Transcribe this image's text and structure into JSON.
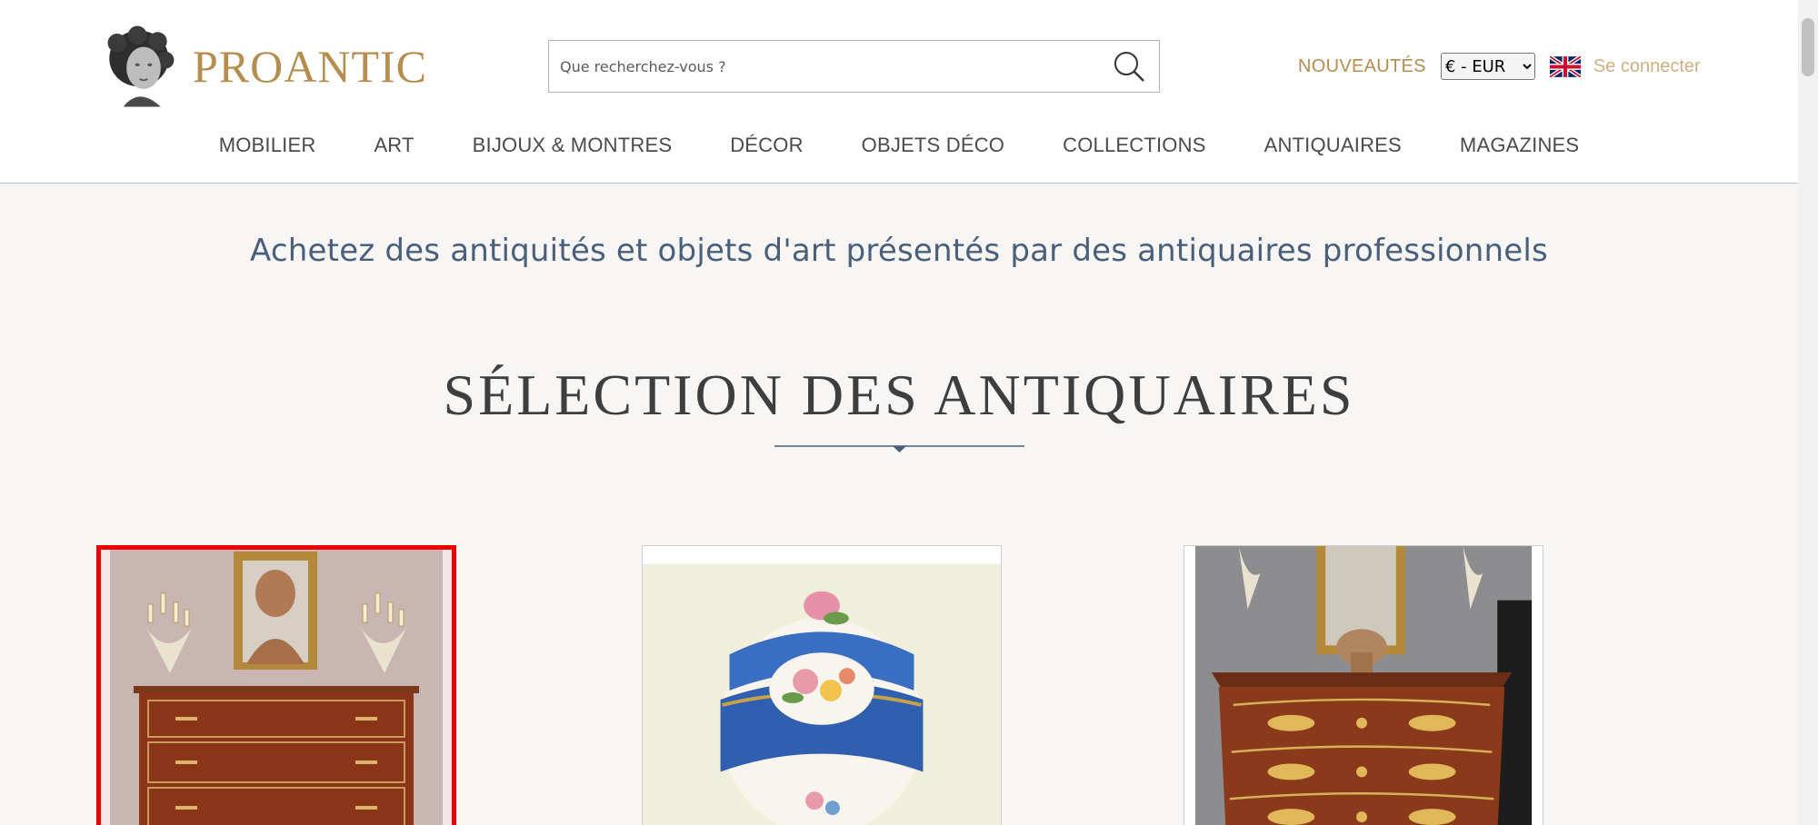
{
  "header": {
    "logo_text": "PROANTIC",
    "search": {
      "placeholder": "Que recherchez-vous ?",
      "value": ""
    },
    "new_link": "NOUVEAUTÉS",
    "currency": {
      "selected": "€ - EUR"
    },
    "language_icon": "uk-flag-icon",
    "login_link": "Se connecter"
  },
  "nav": {
    "items": [
      {
        "label": "MOBILIER"
      },
      {
        "label": "ART"
      },
      {
        "label": "BIJOUX & MONTRES"
      },
      {
        "label": "DÉCOR"
      },
      {
        "label": "OBJETS DÉCO"
      },
      {
        "label": "COLLECTIONS"
      },
      {
        "label": "ANTIQUAIRES"
      },
      {
        "label": "MAGAZINES"
      }
    ]
  },
  "main": {
    "tagline": "Achetez des antiquités et objets d'art présentés par des antiquaires professionnels",
    "section_title": "SÉLECTION DES ANTIQUAIRES"
  },
  "colors": {
    "brand_gold": "#b58d4f",
    "tagline_blue": "#4a5f7a",
    "selection_red": "#ee0000",
    "page_bg": "#f7f6f4"
  }
}
